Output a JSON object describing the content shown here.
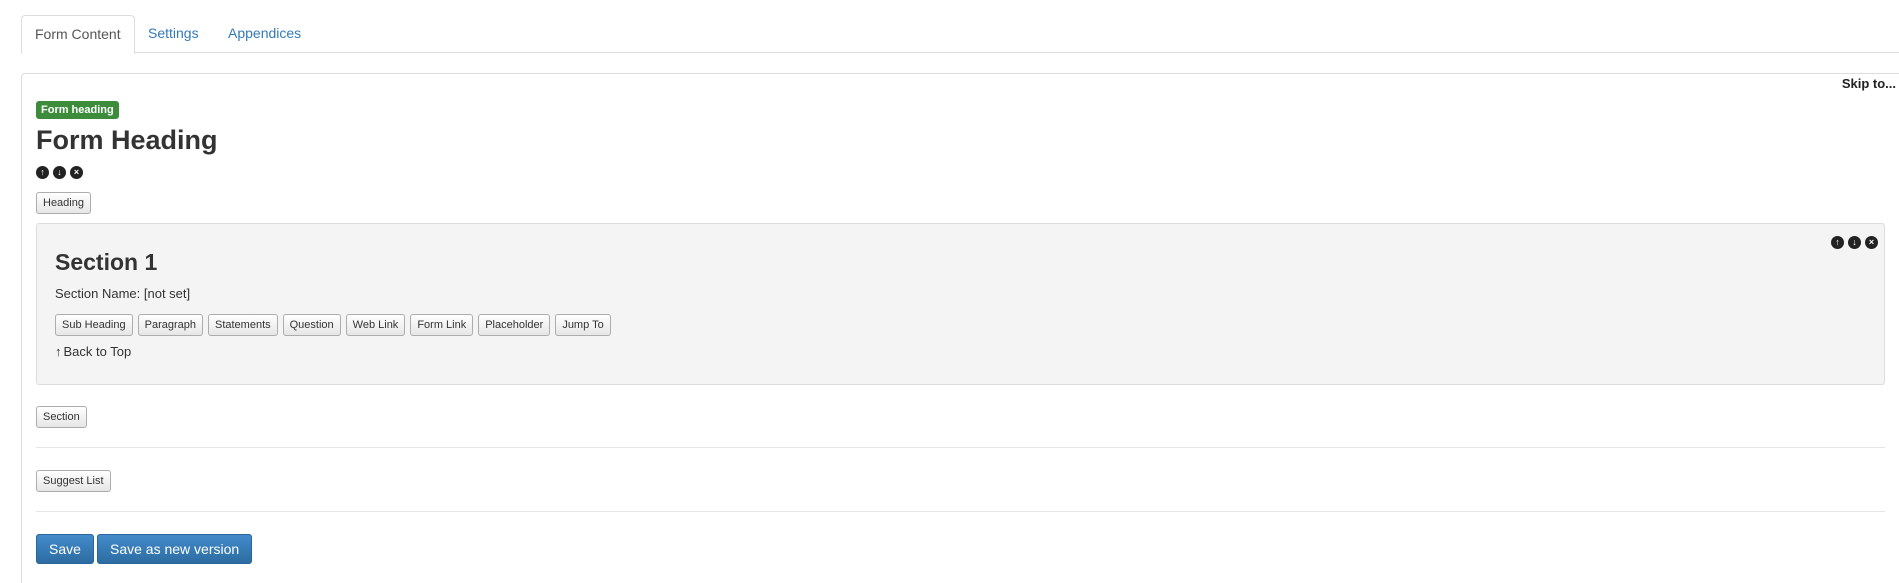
{
  "tabs": [
    {
      "label": "Form Content",
      "active": true
    },
    {
      "label": "Settings",
      "active": false
    },
    {
      "label": "Appendices",
      "active": false
    }
  ],
  "panel": {
    "skip_to": "Skip to...",
    "heading_badge": "Form heading",
    "form_title": "Form Heading",
    "heading_button": "Heading",
    "section": {
      "title": "Section 1",
      "name_text": "Section Name: [not set]",
      "buttons": [
        "Sub Heading",
        "Paragraph",
        "Statements",
        "Question",
        "Web Link",
        "Form Link",
        "Placeholder",
        "Jump To"
      ],
      "back_to_top": "Back to Top"
    },
    "section_button": "Section",
    "suggest_list_button": "Suggest List"
  },
  "actions": {
    "save": "Save",
    "save_new_version": "Save as new version"
  },
  "icons": {
    "move_up": "arrow-up-circle-icon",
    "move_down": "arrow-down-circle-icon",
    "remove": "remove-circle-icon"
  },
  "colors": {
    "badge": "#3c8c3c",
    "link": "#337ab7",
    "primary": "#337ab7"
  }
}
